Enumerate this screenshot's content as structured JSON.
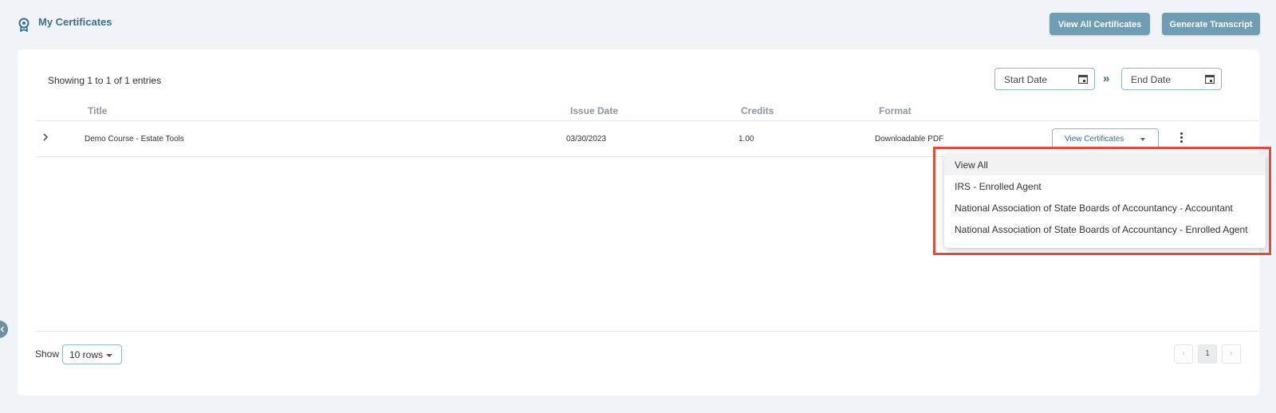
{
  "header": {
    "title": "My Certificates",
    "title_icon": "certificate-badge-icon",
    "buttons": {
      "view_all": "View All Certificates",
      "transcript": "Generate Transcript"
    }
  },
  "table": {
    "entries_info": "Showing 1 to 1 of 1 entries",
    "filters": {
      "start_placeholder": "Start Date",
      "end_placeholder": "End Date",
      "range_separator": "»"
    },
    "columns": [
      "Title",
      "Issue Date",
      "Credits",
      "Format"
    ],
    "rows": [
      {
        "title": "Demo Course - Estate Tools",
        "issue_date": "03/30/2023",
        "credits": "1.00",
        "format": "Downloadable PDF",
        "action_label": "View Certificates"
      }
    ]
  },
  "dropdown": {
    "items": [
      "View All",
      "IRS - Enrolled Agent",
      "National Association of State Boards of Accountancy - Accountant",
      "National Association of State Boards of Accountancy - Enrolled Agent"
    ]
  },
  "footer": {
    "show_label": "Show",
    "rows_value": "10 rows",
    "pagination": {
      "prev": "‹",
      "current": "1",
      "next": "›"
    }
  },
  "colors": {
    "accent": "#3a6f8f",
    "button_bg": "#6e9db4",
    "highlight": "#e54b3c"
  }
}
